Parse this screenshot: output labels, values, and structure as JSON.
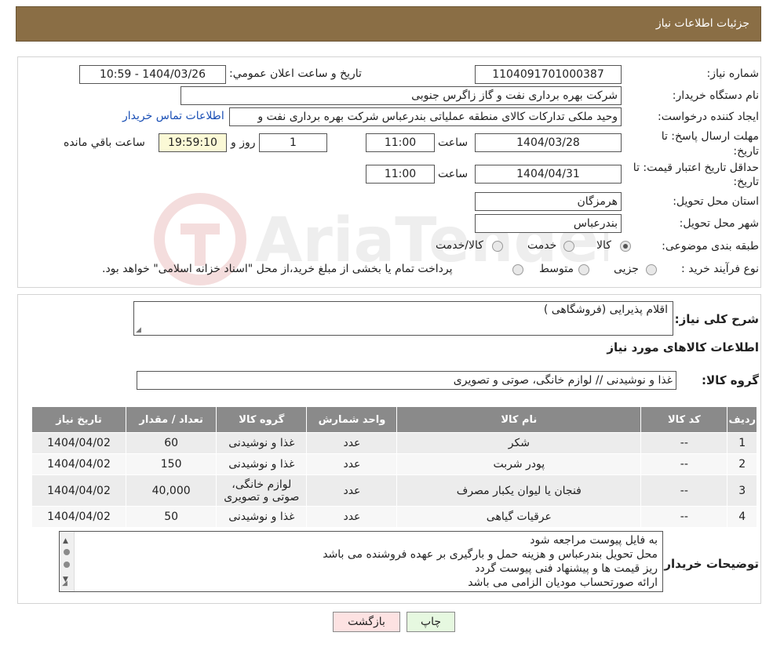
{
  "header": {
    "title": "جزئیات اطلاعات نیاز"
  },
  "watermark": "AriaTender.neT",
  "details": {
    "need_number_label": "شماره نیاز:",
    "need_number": "1104091701000387",
    "announce_label": "تاريخ و ساعت اعلان عمومي:",
    "announce_value": "1404/03/26 - 10:59",
    "buyer_org_label": "نام دستگاه خریدار:",
    "buyer_org": "شرکت بهره برداری نفت و گاز زاگرس جنوبی",
    "creator_label": "ایجاد کننده درخواست:",
    "creator": "وحید ملکی تدارکات کالای منطقه عملیاتی بندرعباس شرکت بهره برداری نفت و",
    "contact_link": "اطلاعات تماس خریدار",
    "deadline_label_1": "مهلت ارسال پاسخ: تا",
    "deadline_label_2": "تاریخ:",
    "deadline_date": "1404/03/28",
    "time_label": "ساعت",
    "deadline_time": "11:00",
    "days_value": "1",
    "days_label": "روز و",
    "remaining_time": "19:59:10",
    "remaining_label": "ساعت باقي مانده",
    "price_valid_label_1": "حداقل تاریخ اعتبار قیمت: تا",
    "price_valid_label_2": "تاریخ:",
    "price_valid_date": "1404/04/31",
    "price_valid_time": "11:00",
    "province_label": "استان محل تحویل:",
    "province": "هرمزگان",
    "city_label": "شهر محل تحویل:",
    "city": "بندرعباس",
    "category_label": "طبقه بندی موضوعی:",
    "category_options": [
      "کالا",
      "خدمت",
      "کالا/خدمت"
    ],
    "process_label": "نوع فرآیند خرید :",
    "process_options": [
      "جزیی",
      "متوسط"
    ],
    "process_note": "پرداخت تمام یا بخشی از مبلغ خرید،از محل \"اسناد خزانه اسلامی\" خواهد بود."
  },
  "summary": {
    "description_label": "شرح کلی نیاز:",
    "description": "اقلام پذیرایی (فروشگاهی )",
    "goods_info_title": "اطلاعات کالاهای مورد نیاز",
    "goods_group_label": "گروه کالا:",
    "goods_group": "غذا و نوشیدنی // لوازم خانگی، صوتی و تصویری"
  },
  "table": {
    "headers": [
      "ردیف",
      "کد کالا",
      "نام کالا",
      "واحد شمارش",
      "گروه کالا",
      "تعداد / مقدار",
      "تاریخ نیاز"
    ],
    "rows": [
      [
        "1",
        "--",
        "شکر",
        "عدد",
        "غذا و نوشیدنی",
        "60",
        "1404/04/02"
      ],
      [
        "2",
        "--",
        "پودر شربت",
        "عدد",
        "غذا و نوشیدنی",
        "150",
        "1404/04/02"
      ],
      [
        "3",
        "--",
        "فنجان یا لیوان یکبار مصرف",
        "عدد",
        "لوازم خانگی، صوتی و تصویری",
        "40,000",
        "1404/04/02"
      ],
      [
        "4",
        "--",
        "عرقیات گیاهی",
        "عدد",
        "غذا و نوشیدنی",
        "50",
        "1404/04/02"
      ]
    ]
  },
  "buyer_notes": {
    "label": "توضیحات خریدار:",
    "lines": [
      "به فایل پیوست مراجعه شود",
      "محل تحویل بندرعباس و هزینه حمل و بارگیری بر عهده فروشنده می باشد",
      "ریز قیمت ها و پیشنهاد فنی پیوست گردد",
      "ارائه صورتحساب مودیان الزامی می باشد"
    ]
  },
  "buttons": {
    "print": "چاپ",
    "back": "بازگشت"
  },
  "colors": {
    "header_bg": "#8a6e45",
    "table_header_bg": "#8a8a8a",
    "link": "#1a4fb5",
    "back_btn_bg": "#fde2e2",
    "print_btn_bg": "#e6f8e0"
  }
}
